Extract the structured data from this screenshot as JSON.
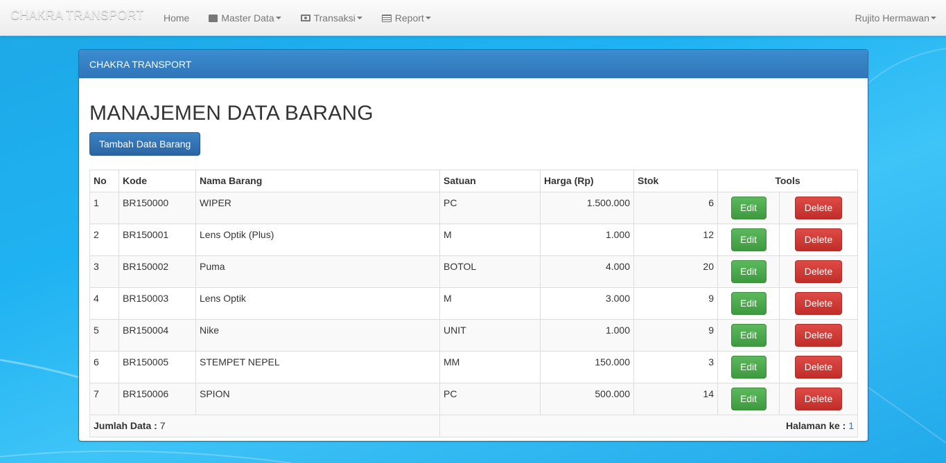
{
  "navbar": {
    "brand": "CHAKRA TRANSPORT",
    "items": [
      {
        "label": "Home",
        "icon": "",
        "dropdown": false
      },
      {
        "label": "Master Data",
        "icon": "box-icon",
        "dropdown": true
      },
      {
        "label": "Transaksi",
        "icon": "money-icon",
        "dropdown": true
      },
      {
        "label": "Report",
        "icon": "list-icon",
        "dropdown": true
      }
    ],
    "user": "Rujito Hermawan"
  },
  "panel": {
    "heading": "CHAKRA TRANSPORT",
    "title": "MANAJEMEN DATA BARANG",
    "add_button": "Tambah Data Barang"
  },
  "table": {
    "headers": {
      "no": "No",
      "kode": "Kode",
      "nama": "Nama Barang",
      "satuan": "Satuan",
      "harga": "Harga (Rp)",
      "stok": "Stok",
      "tools": "Tools"
    },
    "edit_label": "Edit",
    "delete_label": "Delete",
    "rows": [
      {
        "no": "1",
        "kode": "BR150000",
        "nama": "WIPER",
        "satuan": "PC",
        "harga": "1.500.000",
        "stok": "6"
      },
      {
        "no": "2",
        "kode": "BR150001",
        "nama": "Lens Optik (Plus)",
        "satuan": "M",
        "harga": "1.000",
        "stok": "12"
      },
      {
        "no": "3",
        "kode": "BR150002",
        "nama": "Puma",
        "satuan": "BOTOL",
        "harga": "4.000",
        "stok": "20"
      },
      {
        "no": "4",
        "kode": "BR150003",
        "nama": "Lens Optik",
        "satuan": "M",
        "harga": "3.000",
        "stok": "9"
      },
      {
        "no": "5",
        "kode": "BR150004",
        "nama": "Nike",
        "satuan": "UNIT",
        "harga": "1.000",
        "stok": "9"
      },
      {
        "no": "6",
        "kode": "BR150005",
        "nama": "STEMPET NEPEL",
        "satuan": "MM",
        "harga": "150.000",
        "stok": "3"
      },
      {
        "no": "7",
        "kode": "BR150006",
        "nama": "SPION",
        "satuan": "PC",
        "harga": "500.000",
        "stok": "14"
      }
    ],
    "footer": {
      "count_label": "Jumlah Data :",
      "count_value": "7",
      "page_label": "Halaman ke :",
      "page_value": "1"
    }
  },
  "colors": {
    "navbar_bg": "#f0f0f0",
    "panel_heading": "#337ab7",
    "edit_btn": "#5cb85c",
    "delete_btn": "#d9534f",
    "background": "#1fb2f2"
  }
}
